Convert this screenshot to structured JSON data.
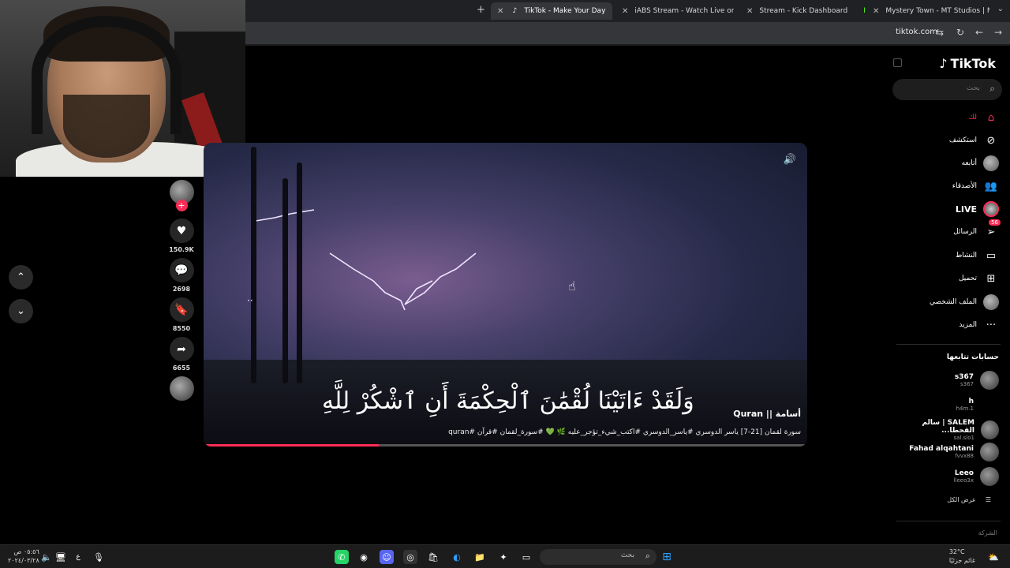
{
  "browser": {
    "tabs": [
      {
        "label": "TikTok - Make Your Day",
        "active": true,
        "favicon": "tiktok-icon"
      },
      {
        "label": "iABS Stream - Watch Live on Ki",
        "active": false,
        "favicon": "kick-icon"
      },
      {
        "label": "Stream - Kick Dashboard",
        "active": false,
        "favicon": "kick-icon"
      },
      {
        "label": "Mystery Town - MT Studios | M",
        "active": false,
        "favicon": "site-icon"
      }
    ],
    "url": "tiktok.com"
  },
  "video": {
    "verse": "وَلَقَدْ ءَاتَيْنَا لُقْمَٰنَ ٱلْحِكْمَةَ أَنِ ٱشْكُرْ لِلَّهِ",
    "author": "أسامة || Quran",
    "caption": "سورة لقمان [21-7] ياسر الدوسري #ياسر_الدوسري #اكتب_شيء_تؤجر_عليه 🌿 💚 #سورة_لقمان #قرآن #quran",
    "progress": 0.29
  },
  "actions": {
    "likes": "150.9K",
    "comments": "2698",
    "saves": "8550",
    "shares": "6655"
  },
  "sidebar": {
    "logo": "TikTok",
    "search_placeholder": "بحث",
    "menu": [
      {
        "label": "لك",
        "icon": "home-icon"
      },
      {
        "label": "استكشف",
        "icon": "compass-icon"
      },
      {
        "label": "أتابعه",
        "icon": "avatar-icon"
      },
      {
        "label": "الأصدقاء",
        "icon": "friends-icon"
      },
      {
        "label": "LIVE",
        "icon": "live-icon"
      },
      {
        "label": "الرسائل",
        "icon": "messages-icon",
        "badge": "56"
      },
      {
        "label": "النشاط",
        "icon": "activity-icon"
      },
      {
        "label": "تحميل",
        "icon": "upload-icon"
      },
      {
        "label": "الملف الشخصي",
        "icon": "profile-icon"
      },
      {
        "label": "المزيد",
        "icon": "more-icon"
      }
    ],
    "following_title": "حسابات تتابعها",
    "following": [
      {
        "name": "s367",
        "handle": "s367"
      },
      {
        "name": "h",
        "handle": "h4m.1"
      },
      {
        "name": "SALEM | سالم القحطا...",
        "handle": "sal.slo1"
      },
      {
        "name": "Fahad alqahtani",
        "handle": "fvvx88"
      },
      {
        "name": "Leeo",
        "handle": "lleeo3x"
      }
    ],
    "see_all": "عرض الكل",
    "company": "الشركة"
  },
  "taskbar": {
    "search_label": "بحث",
    "time": "٠٥:٥٦ ص",
    "date": "٢٠٢٤/٠٣/٢٨",
    "weather_temp": "32°C",
    "weather_desc": "غائم جزئيًا",
    "lang": "ع"
  },
  "colors": {
    "accent": "#fe2c55",
    "background": "#000000"
  }
}
